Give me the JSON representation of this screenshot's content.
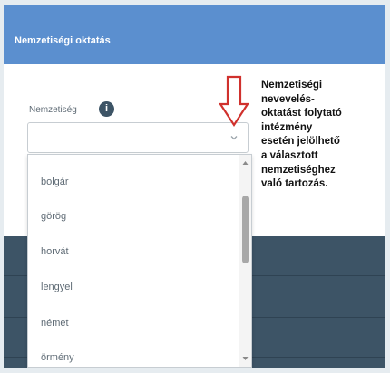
{
  "header": {
    "title": "Nemzetiségi oktatás"
  },
  "field": {
    "label": "Nemzetiség",
    "info_icon": "info-icon",
    "value": ""
  },
  "dropdown": {
    "options": [
      "bolgár",
      "görög",
      "horvát",
      "lengyel",
      "német",
      "örmény"
    ]
  },
  "hint": {
    "text": "Nemzetiségi\nnevevelés-\noktatást folytató\nintézmény\nesetén jelölhető\na választott\nnemzetiséghez\nvaló tartozás."
  },
  "colors": {
    "header": "#5b8fcf",
    "arrow": "#d0312d",
    "background_rows": "#3d5466"
  }
}
